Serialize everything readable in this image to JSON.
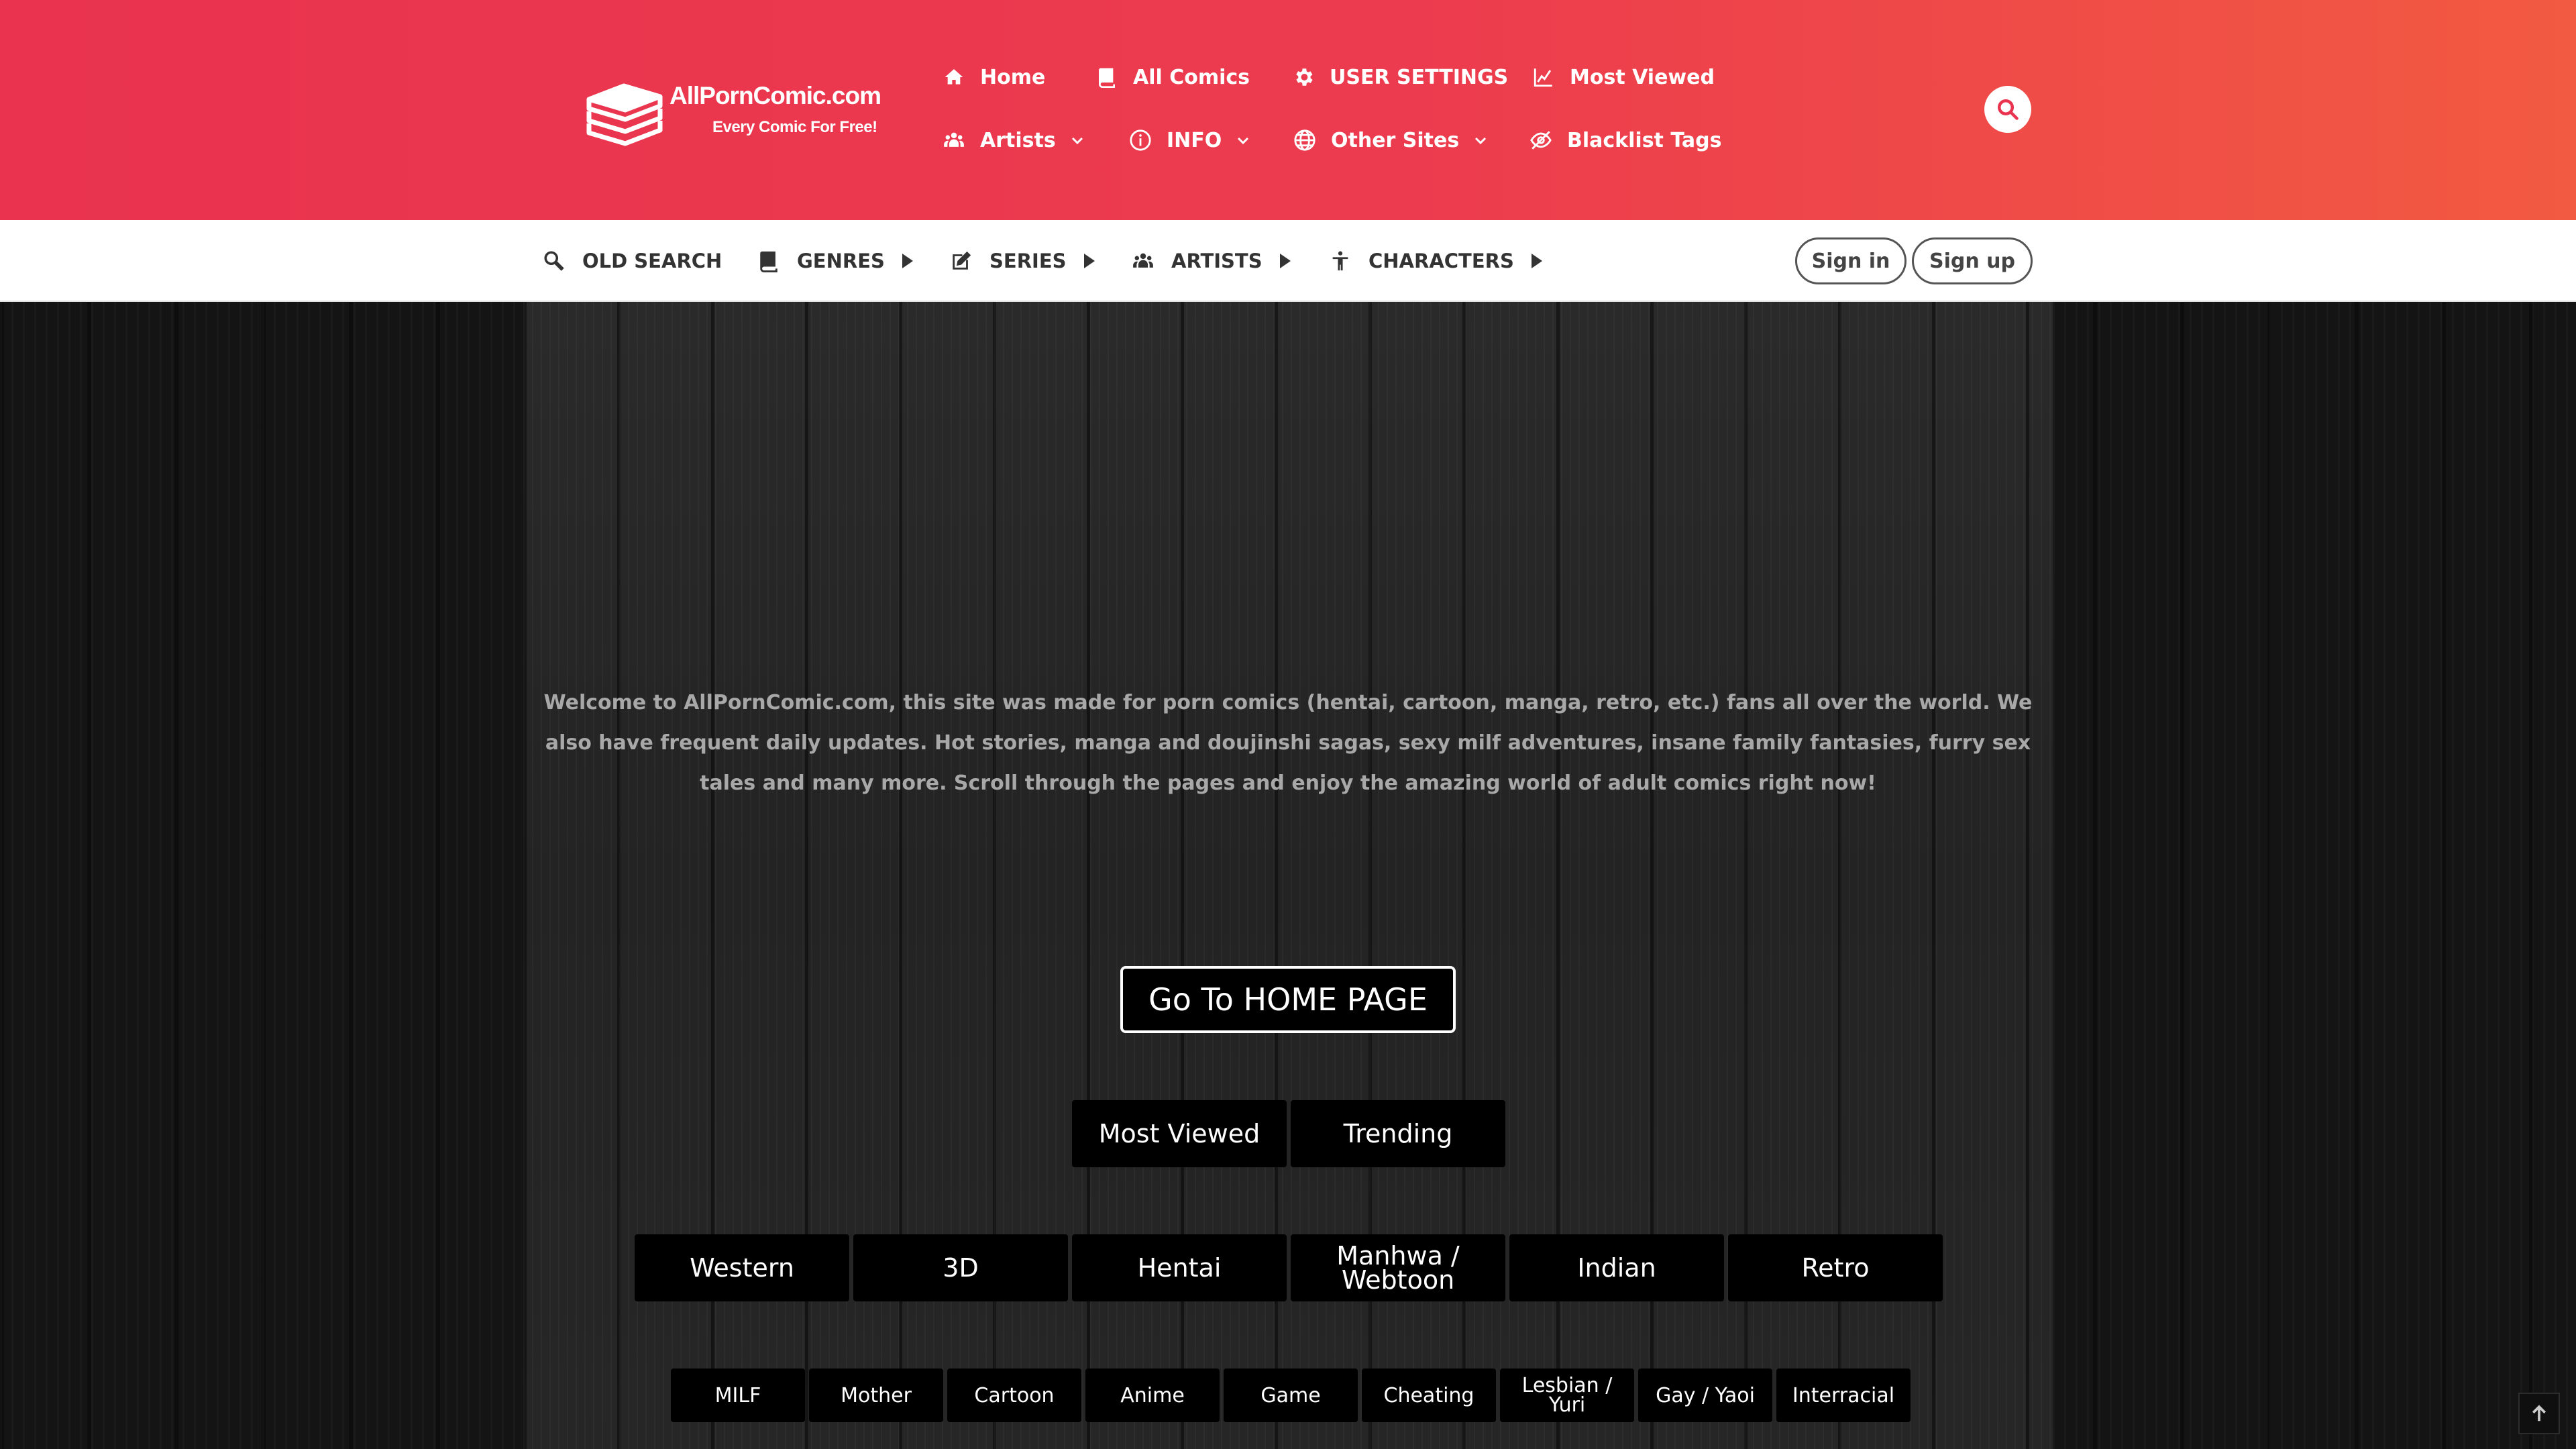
{
  "brand": {
    "name": "AllPornComic.com",
    "tagline": "Every Comic For Free!"
  },
  "colors": {
    "header_gradient_start": "#e9334f",
    "header_gradient_end": "#f25a41",
    "subnav_bg": "#ffffff",
    "button_bg": "#000000",
    "button_text": "#ffffff",
    "welcome_text": "#a8a8a8"
  },
  "top_nav": {
    "row1": [
      {
        "label": "Home",
        "icon": "home-icon"
      },
      {
        "label": "All Comics",
        "icon": "book-icon"
      },
      {
        "label": "USER SETTINGS",
        "icon": "gear-icon"
      },
      {
        "label": "Most Viewed",
        "icon": "trend-chart-icon"
      }
    ],
    "row2": [
      {
        "label": "Artists",
        "icon": "group-icon",
        "dropdown": true
      },
      {
        "label": "INFO",
        "icon": "info-icon",
        "dropdown": true
      },
      {
        "label": "Other Sites",
        "icon": "globe-icon",
        "dropdown": true
      },
      {
        "label": "Blacklist Tags",
        "icon": "eye-slash-icon"
      }
    ],
    "search_icon": "search-icon"
  },
  "sub_nav": {
    "items": [
      {
        "label": "OLD SEARCH",
        "icon": "magnifier-icon"
      },
      {
        "label": "GENRES",
        "icon": "book-icon"
      },
      {
        "label": "SERIES",
        "icon": "edit-icon"
      },
      {
        "label": "ARTISTS",
        "icon": "group-icon"
      },
      {
        "label": "CHARACTERS",
        "icon": "person-icon"
      }
    ],
    "signin": "Sign in",
    "signup": "Sign up"
  },
  "main": {
    "welcome": "Welcome to AllPornComic.com, this site was made for porn comics (hentai, cartoon, manga, retro, etc.) fans all over the world. We also have frequent daily updates. Hot stories, manga and doujinshi sagas, sexy milf adventures, insane family fantasies, furry sex tales and many more. Scroll through the pages and enjoy the amazing world of adult comics right now!",
    "home_button": "Go To HOME PAGE",
    "sort_buttons": [
      "Most Viewed",
      "Trending"
    ],
    "category_buttons": [
      "Western",
      "3D",
      "Hentai",
      "Manhwa / Webtoon",
      "Indian",
      "Retro"
    ],
    "tag_buttons": [
      "MILF",
      "Mother",
      "Cartoon",
      "Anime",
      "Game",
      "Cheating",
      "Lesbian / Yuri",
      "Gay / Yaoi",
      "Interracial"
    ]
  },
  "scroll_top_icon": "arrow-up-icon"
}
